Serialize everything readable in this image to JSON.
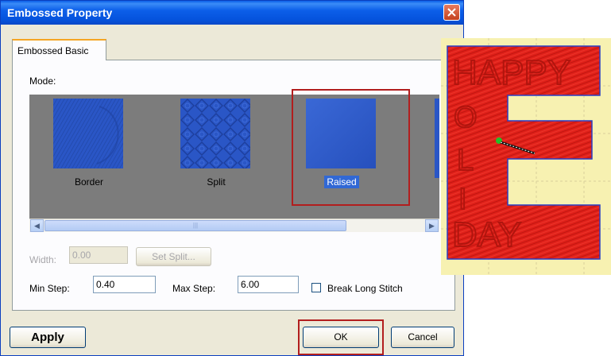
{
  "dialog": {
    "title": "Embossed Property",
    "tab_label": "Embossed Basic",
    "mode_label": "Mode:",
    "modes": [
      {
        "label": "Border",
        "selected": false
      },
      {
        "label": "Split",
        "selected": false
      },
      {
        "label": "Raised",
        "selected": true
      }
    ],
    "width_label": "Width:",
    "width_value": "0.00",
    "set_split_label": "Set Split...",
    "min_step_label": "Min Step:",
    "min_step_value": "0.40",
    "max_step_label": "Max Step:",
    "max_step_value": "6.00",
    "break_long_stitch_label": "Break Long Stitch",
    "break_long_stitch_checked": false,
    "apply_label": "Apply",
    "ok_label": "OK",
    "cancel_label": "Cancel"
  },
  "preview": {
    "text_lines": [
      "HAPPY",
      "O",
      "L",
      "I",
      "DAY"
    ]
  },
  "colors": {
    "title_bar": "#0a5ee8",
    "swatch_blue": "#2a56c6",
    "embroidery_red": "#e0201a",
    "highlight_red": "#b21e1e",
    "preview_bg": "#f7f1b1"
  }
}
